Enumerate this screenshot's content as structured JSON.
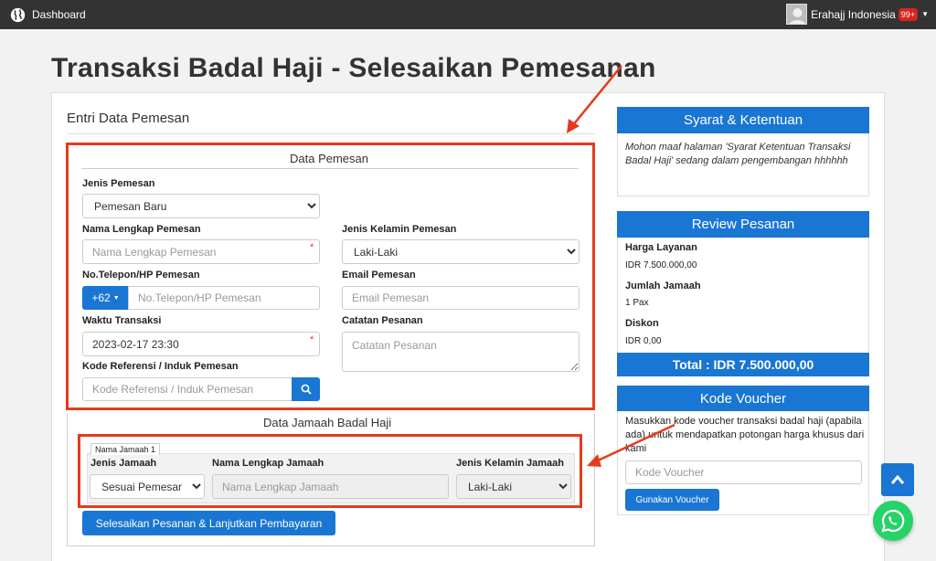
{
  "navbar": {
    "brand": "Dashboard",
    "user": "Erahajj Indonesia",
    "badge": "99+"
  },
  "page": {
    "title": "Transaksi Badal Haji - Selesaikan Pemesanan"
  },
  "form": {
    "section_title": "Entri Data Pemesan",
    "data_pemesan": {
      "legend": "Data Pemesan",
      "jenis_pemesan": {
        "label": "Jenis Pemesan",
        "value": "Pemesan Baru"
      },
      "nama": {
        "label": "Nama Lengkap Pemesan",
        "placeholder": "Nama Lengkap Pemesan",
        "required_mark": "*"
      },
      "jenis_kelamin": {
        "label": "Jenis Kelamin Pemesan",
        "value": "Laki-Laki"
      },
      "telepon": {
        "label": "No.Telepon/HP Pemesan",
        "prefix": "+62",
        "placeholder": "No.Telepon/HP Pemesan"
      },
      "email": {
        "label": "Email Pemesan",
        "placeholder": "Email Pemesan"
      },
      "waktu": {
        "label": "Waktu Transaksi",
        "value": "2023-02-17 23:30",
        "required_mark": "*"
      },
      "catatan": {
        "label": "Catatan Pesanan",
        "placeholder": "Catatan Pesanan"
      },
      "kode_ref": {
        "label": "Kode Referensi / Induk Pemesan",
        "placeholder": "Kode Referensi / Induk Pemesan"
      }
    },
    "data_jamaah": {
      "legend": "Data Jamaah Badal Haji",
      "tab": "Nama Jamaah 1",
      "jenis_jamaah": {
        "label": "Jenis Jamaah",
        "value": "Sesuai Pemesan"
      },
      "nama": {
        "label": "Nama Lengkap Jamaah",
        "placeholder": "Nama Lengkap Jamaah"
      },
      "jenis_kelamin": {
        "label": "Jenis Kelamin Jamaah",
        "value": "Laki-Laki"
      }
    },
    "submit": "Selesaikan Pesanan & Lanjutkan Pembayaran"
  },
  "sidebar": {
    "syarat": {
      "title": "Syarat & Ketentuan",
      "text": "Mohon maaf halaman 'Syarat Ketentuan Transaksi Badal Haji' sedang dalam pengembangan hhhhhh"
    },
    "review": {
      "title": "Review Pesanan",
      "harga_label": "Harga Layanan",
      "harga_value": "IDR 7.500.000,00",
      "jumlah_label": "Jumlah Jamaah",
      "jumlah_value": "1 Pax",
      "diskon_label": "Diskon",
      "diskon_value": "IDR 0,00",
      "total": "Total : IDR 7.500.000,00"
    },
    "voucher": {
      "title": "Kode Voucher",
      "text": "Masukkan kode voucher transaksi badal haji (apabila ada) untuk mendapatkan potongan harga khusus dari kami",
      "placeholder": "Kode Voucher",
      "button": "Gunakan Voucher"
    }
  },
  "colors": {
    "navbar": "#333333",
    "primary": "#1976d2",
    "annotation": "#e63a1e",
    "whatsapp": "#25d366"
  },
  "icons": [
    "globe-icon",
    "caret-down-icon",
    "search-icon",
    "chevron-up-icon",
    "whatsapp-icon",
    "annotation-arrow"
  ]
}
